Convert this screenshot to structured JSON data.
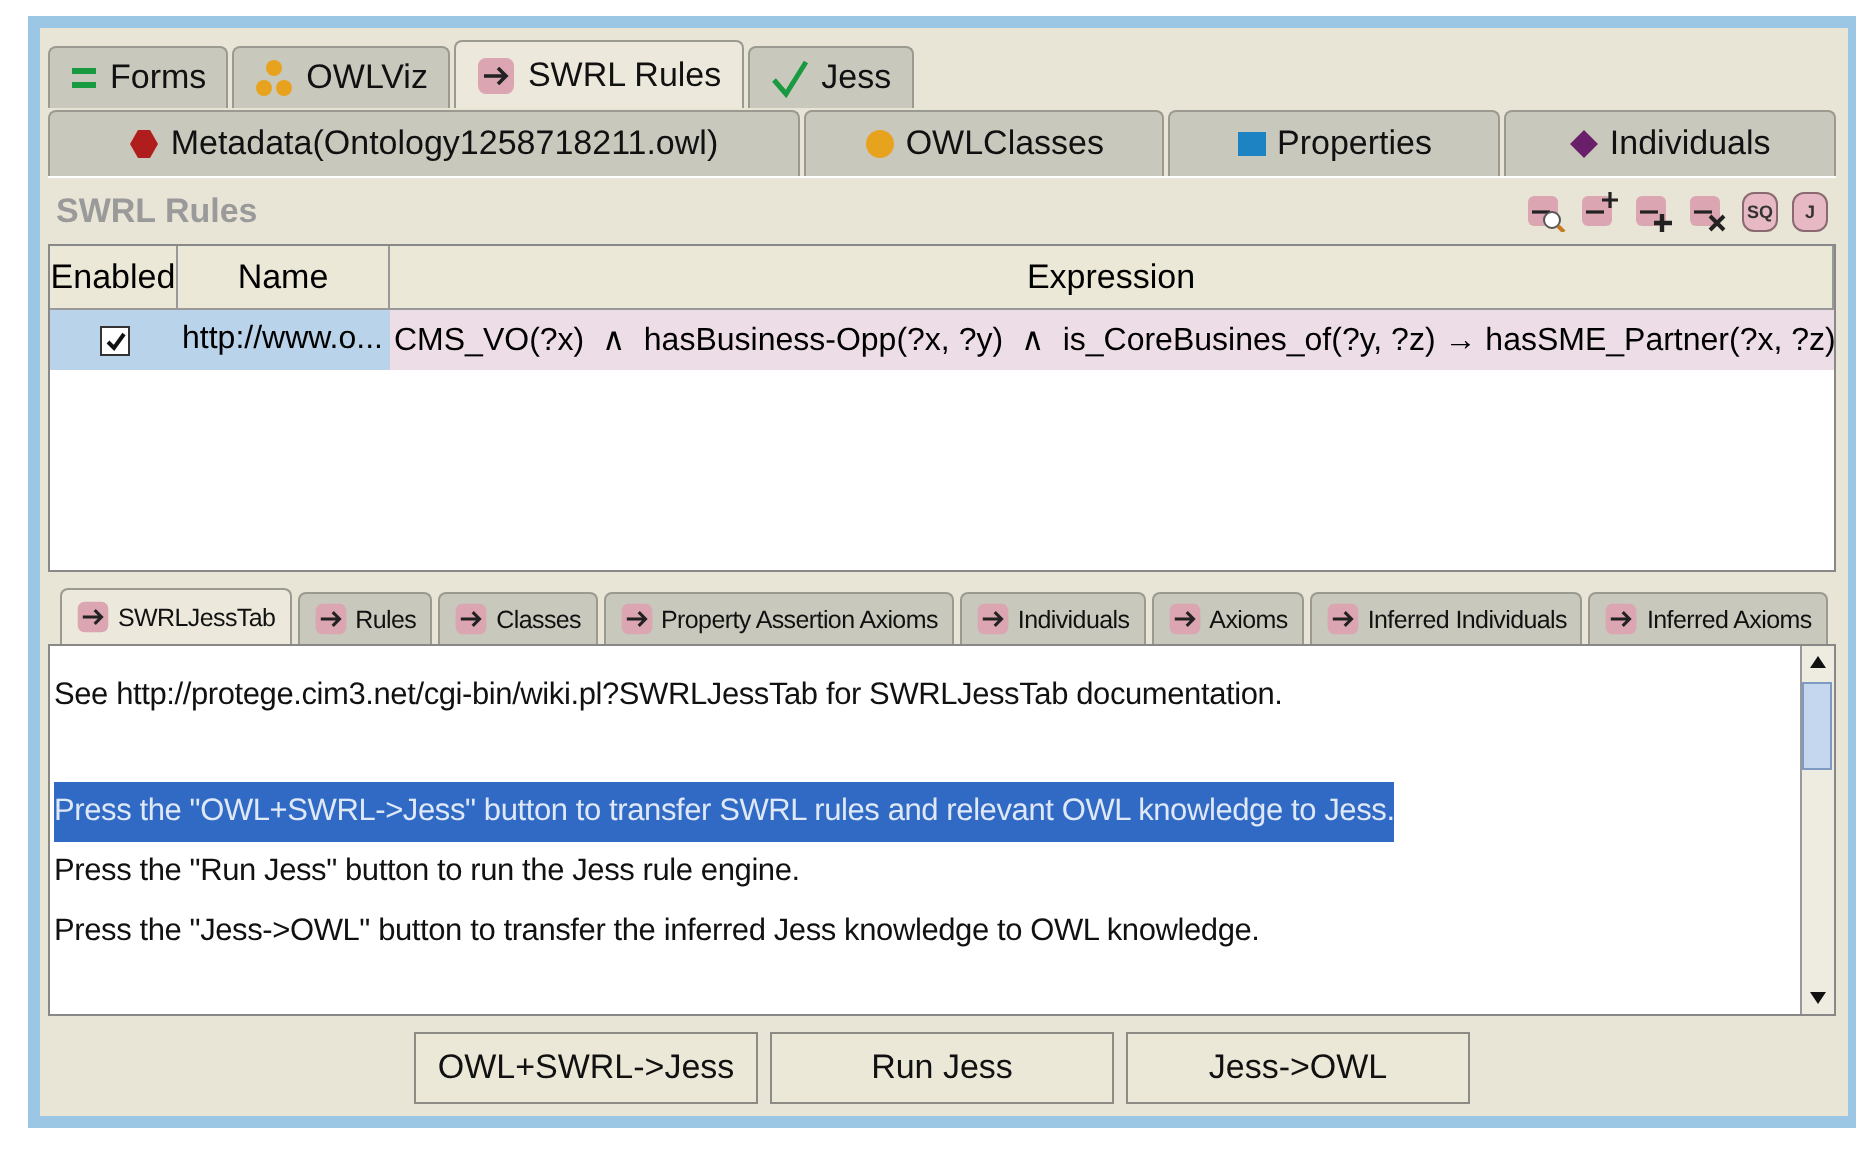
{
  "main_tabs": [
    {
      "label": "Forms",
      "selected": false
    },
    {
      "label": "OWLViz",
      "selected": false
    },
    {
      "label": "SWRL Rules",
      "selected": true
    },
    {
      "label": "Jess",
      "selected": false
    }
  ],
  "sub_tabs": [
    {
      "label": "Metadata(Ontology1258718211.owl)"
    },
    {
      "label": "OWLClasses"
    },
    {
      "label": "Properties"
    },
    {
      "label": "Individuals"
    }
  ],
  "panel": {
    "title": "SWRL Rules",
    "tools": [
      {
        "kind": "find"
      },
      {
        "kind": "copy"
      },
      {
        "kind": "add"
      },
      {
        "kind": "delete"
      },
      {
        "kind": "label",
        "label": "SQ"
      },
      {
        "kind": "label",
        "label": "J"
      }
    ]
  },
  "table": {
    "columns": [
      "Enabled",
      "Name",
      "Expression"
    ],
    "rows": [
      {
        "enabled": true,
        "selected": true,
        "name": "http://www.o...",
        "expression": "CMS_VO(?x)  ∧  hasBusiness-Opp(?x, ?y)  ∧  is_CoreBusines_of(?y, ?z) → hasSME_Partner(?x, ?z)"
      }
    ]
  },
  "lower_tabs": [
    {
      "label": "SWRLJessTab",
      "selected": true
    },
    {
      "label": "Rules",
      "selected": false
    },
    {
      "label": "Classes",
      "selected": false
    },
    {
      "label": "Property Assertion Axioms",
      "selected": false
    },
    {
      "label": "Individuals",
      "selected": false
    },
    {
      "label": "Axioms",
      "selected": false
    },
    {
      "label": "Inferred Individuals",
      "selected": false
    },
    {
      "label": "Inferred Axioms",
      "selected": false
    }
  ],
  "console": [
    {
      "text": "See http://protege.cim3.net/cgi-bin/wiki.pl?SWRLJessTab for SWRLJessTab documentation.",
      "selected": false
    },
    {
      "text": "Press the \"OWL+SWRL->Jess\" button to transfer SWRL rules and relevant OWL knowledge to Jess.",
      "selected": true
    },
    {
      "text": "Press the \"Run Jess\" button to run the Jess rule engine.",
      "selected": false
    },
    {
      "text": "Press the \"Jess->OWL\" button to transfer the inferred Jess knowledge to OWL knowledge.",
      "selected": false
    }
  ],
  "buttons": [
    "OWL+SWRL->Jess",
    "Run Jess",
    "Jess->OWL"
  ]
}
